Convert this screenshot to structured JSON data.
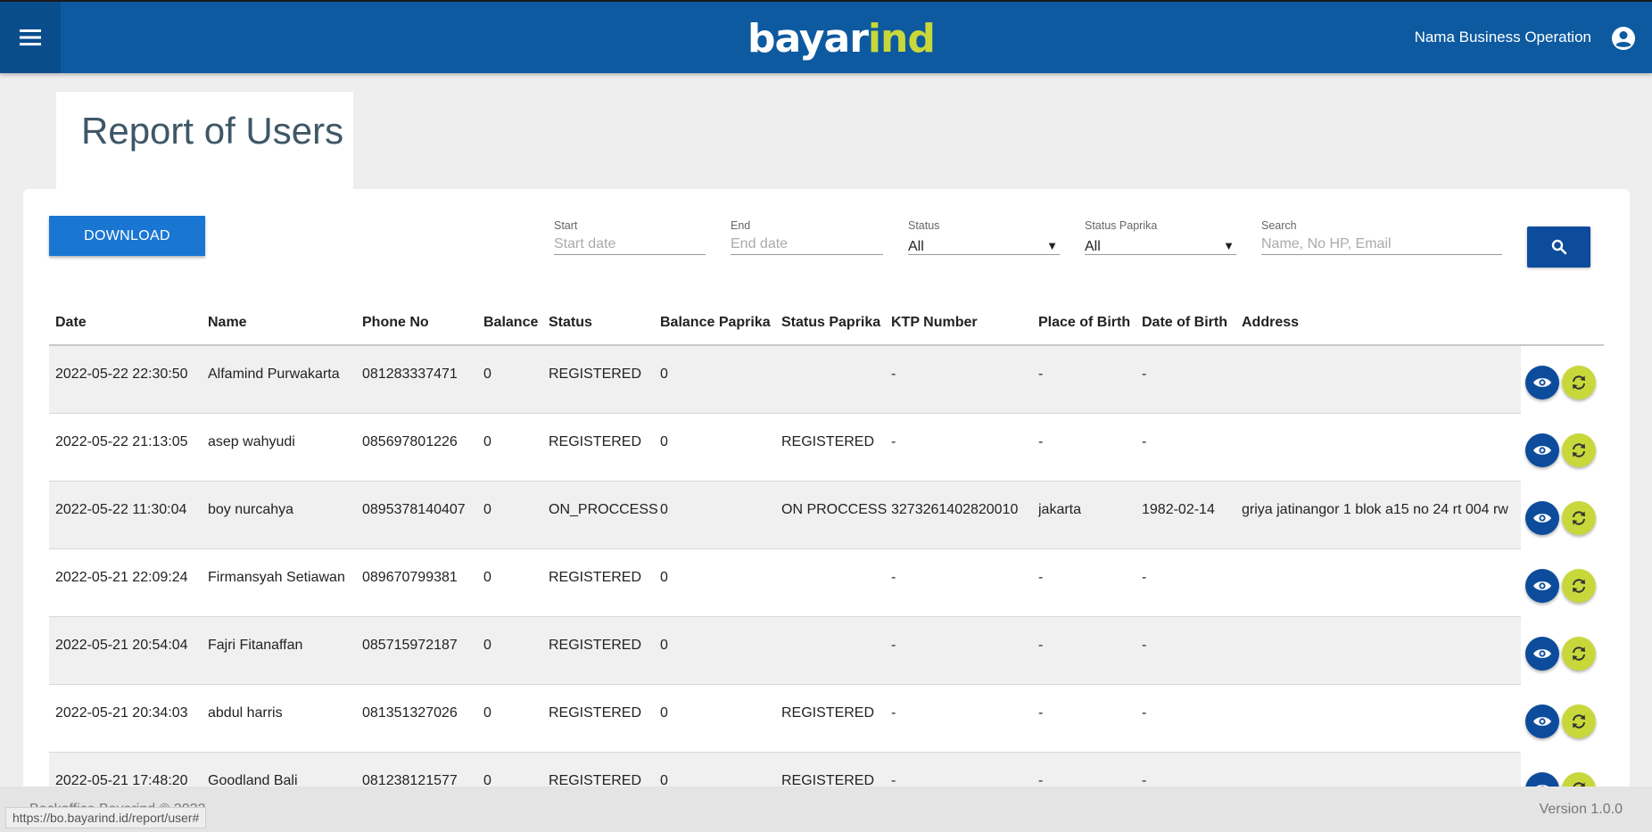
{
  "header": {
    "logo_main": "bayar",
    "logo_accent": "ind",
    "user_name": "Nama Business Operation"
  },
  "page": {
    "title": "Report of Users"
  },
  "toolbar": {
    "download_label": "DOWNLOAD",
    "start": {
      "label": "Start",
      "placeholder": "Start date"
    },
    "end": {
      "label": "End",
      "placeholder": "End date"
    },
    "status": {
      "label": "Status",
      "value": "All"
    },
    "status_paprika": {
      "label": "Status Paprika",
      "value": "All"
    },
    "search": {
      "label": "Search",
      "placeholder": "Name, No HP, Email"
    }
  },
  "table": {
    "columns": [
      "Date",
      "Name",
      "Phone No",
      "Balance",
      "Status",
      "Balance Paprika",
      "Status Paprika",
      "KTP Number",
      "Place of Birth",
      "Date of Birth",
      "Address"
    ],
    "rows": [
      [
        "2022-05-22 22:30:50",
        "Alfamind Purwakarta",
        "081283337471",
        "0",
        "REGISTERED",
        "0",
        "",
        "-",
        "-",
        "-",
        ""
      ],
      [
        "2022-05-22 21:13:05",
        "asep wahyudi",
        "085697801226",
        "0",
        "REGISTERED",
        "0",
        "REGISTERED",
        "-",
        "-",
        "-",
        ""
      ],
      [
        "2022-05-22 11:30:04",
        "boy nurcahya",
        "0895378140407",
        "0",
        "ON_PROCCESS",
        "0",
        "ON PROCCESS",
        "3273261402820010",
        "jakarta",
        "1982-02-14",
        "griya jatinangor 1 blok a15 no 24 rt 004 rw"
      ],
      [
        "2022-05-21 22:09:24",
        "Firmansyah Setiawan",
        "089670799381",
        "0",
        "REGISTERED",
        "0",
        "",
        "-",
        "-",
        "-",
        ""
      ],
      [
        "2022-05-21 20:54:04",
        "Fajri Fitanaffan",
        "085715972187",
        "0",
        "REGISTERED",
        "0",
        "",
        "-",
        "-",
        "-",
        ""
      ],
      [
        "2022-05-21 20:34:03",
        "abdul harris",
        "081351327026",
        "0",
        "REGISTERED",
        "0",
        "REGISTERED",
        "-",
        "-",
        "-",
        ""
      ],
      [
        "2022-05-21 17:48:20",
        "Goodland Bali",
        "081238121577",
        "0",
        "REGISTERED",
        "0",
        "REGISTERED",
        "-",
        "-",
        "-",
        ""
      ]
    ]
  },
  "footer": {
    "copyright": "Backoffice Bayarind © 2022",
    "version": "Version 1.0.0"
  },
  "status_bar": {
    "url": "https://bo.bayarind.id/report/user#"
  },
  "icons": {
    "menu": "menu-icon",
    "account": "account-circle-icon",
    "search": "search-icon",
    "view": "eye-icon",
    "sync": "sync-icon",
    "dropdown": "caret-down-icon"
  },
  "colors": {
    "header": "#0d5aa0",
    "primary_button": "#1976d2",
    "dark_button": "#0d4c9c",
    "accent": "#c8d83a"
  }
}
